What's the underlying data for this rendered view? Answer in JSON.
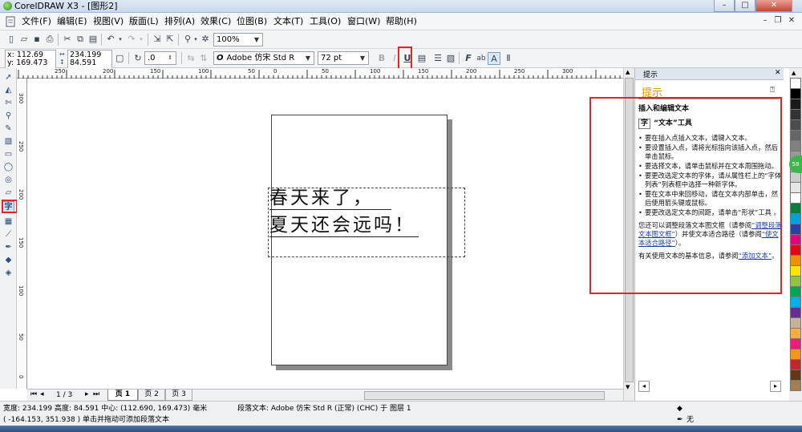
{
  "window": {
    "title": "CorelDRAW X3 - [图形2]"
  },
  "menu": [
    {
      "label": "文件(F)"
    },
    {
      "label": "编辑(E)"
    },
    {
      "label": "视图(V)"
    },
    {
      "label": "版面(L)"
    },
    {
      "label": "排列(A)"
    },
    {
      "label": "效果(C)"
    },
    {
      "label": "位图(B)"
    },
    {
      "label": "文本(T)"
    },
    {
      "label": "工具(O)"
    },
    {
      "label": "窗口(W)"
    },
    {
      "label": "帮助(H)"
    }
  ],
  "toolbar": {
    "zoom": "100%"
  },
  "propbar": {
    "x": "x: 112.69 mm",
    "y": "y: 169.473 mm",
    "w": "234.199 mm",
    "h": "84.591 mm",
    "rotation": ".0",
    "font": "Adobe 仿宋 Std R",
    "size": "72 pt"
  },
  "ruler": {
    "h_labels": [
      "250",
      "200",
      "150",
      "100",
      "50",
      "0",
      "50",
      "100",
      "150",
      "200",
      "250",
      "300"
    ],
    "v_labels": [
      "300",
      "250",
      "200",
      "150",
      "100",
      "50",
      "0"
    ]
  },
  "canvas": {
    "line1": "春天来了，",
    "line2": "夏天还会远吗！"
  },
  "hint": {
    "header": "提示",
    "tab": "提示",
    "title": "插入和编辑文本",
    "tool_name": "“文本”工具",
    "items": [
      "要在插入点插入文本，请键入文本。",
      "要设置插入点，请将光标指向该插入点，然后单击鼠标。",
      "要选择文本，请单击鼠标并在文本周围拖动。",
      "要更改选定文本的字体，请从属性栏上的“字体列表”列表框中选择一种新字体。",
      "要在文本中来回移动，请在文本内部单击，然后使用箭头键或鼠标。",
      "要更改选定文本的间距，请单击“形状”工具 。"
    ],
    "para1_a": "您还可以调整段落文本图文框（请参阅",
    "para1_link1": "“调整段落文本图文框”",
    "para1_b": "）并使文本适合路径（请参阅",
    "para1_link2": "“使文本适合路径”",
    "para1_c": "）。",
    "para2_a": "有关使用文本的基本信息，请参阅",
    "para2_link": "“添加文本”",
    "para2_b": "。"
  },
  "pagetabs": {
    "counter": "1 / 3",
    "tabs": [
      "页 1",
      "页 2",
      "页 3"
    ]
  },
  "status": {
    "line1": "宽度: 234.199 高度: 84.591 中心: (112.690, 169.473) 毫米",
    "line1_right": "段落文本: Adobe 仿宋 Std R (正常) (CHC) 于 图层 1",
    "line2": "( -164.153, 351.938 )   单击并拖动可添加段落文本",
    "fill": "无"
  },
  "palette": [
    "#ffffff",
    "#000000",
    "#1a1a1a",
    "#333333",
    "#4d4d4d",
    "#666666",
    "#808080",
    "#999999",
    "#b3b3b3",
    "#cccccc",
    "#e6e6e6",
    "#ffffff",
    "#0a7e3a",
    "#00a0e0",
    "#2b3fa8",
    "#e5007e",
    "#e30613",
    "#f29100",
    "#ffe600",
    "#8dc63f",
    "#00a651",
    "#00aeef",
    "#662d91",
    "#c7b299",
    "#fbb03b",
    "#ed1e79",
    "#f7941d",
    "#c1272d",
    "#603813",
    "#a67c52"
  ],
  "colors": {
    "accent_red": "#e0262b",
    "hint_title": "#f29100"
  }
}
